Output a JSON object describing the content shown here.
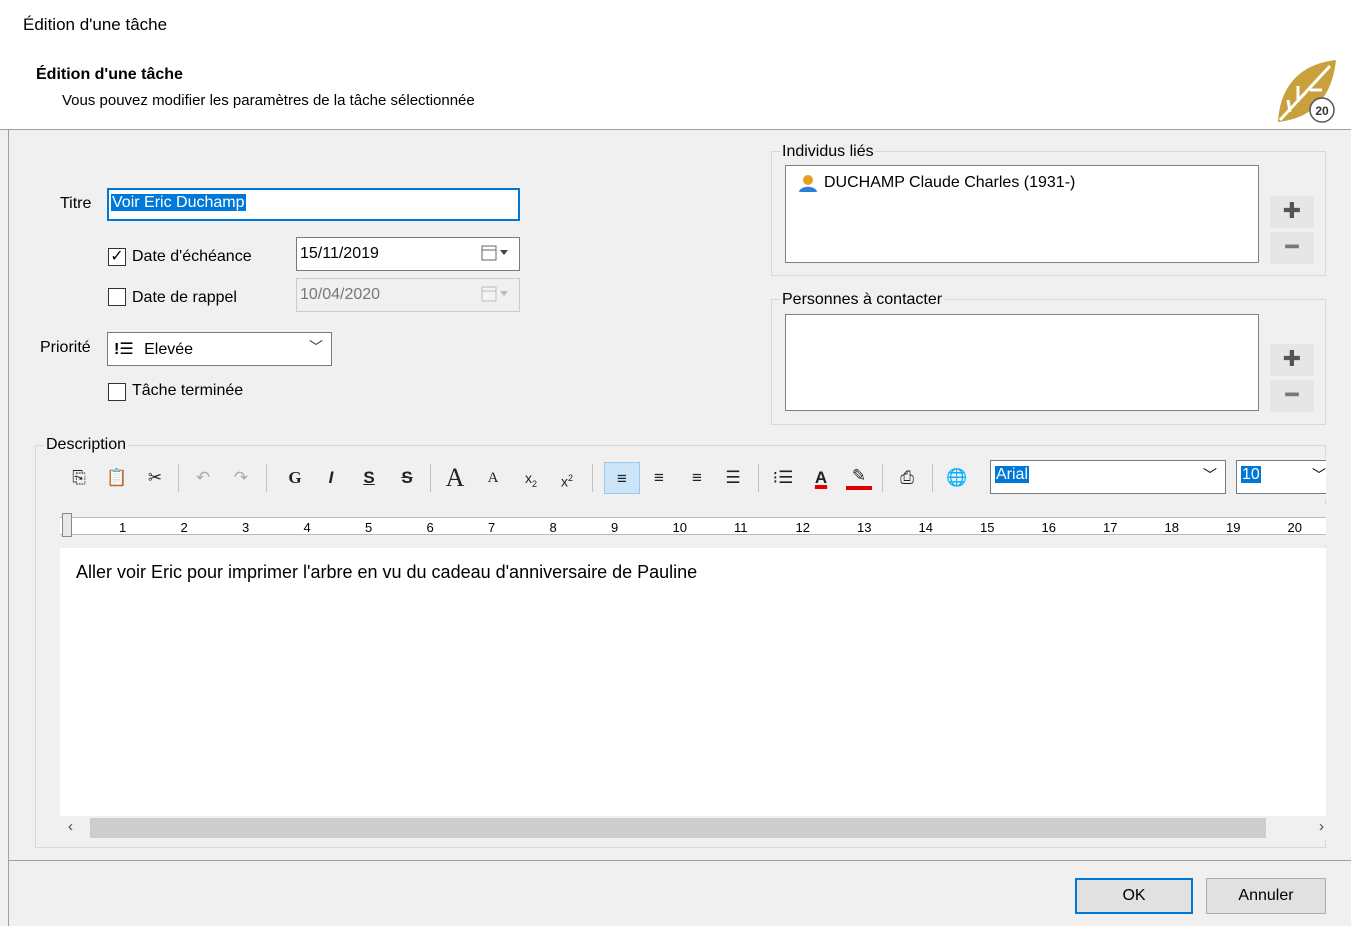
{
  "window": {
    "title": "Édition d'une tâche"
  },
  "banner": {
    "title": "Édition d'une tâche",
    "subtitle": "Vous pouvez modifier les paramètres de la tâche sélectionnée",
    "logo_text": "20"
  },
  "form": {
    "title_label": "Titre",
    "title_value": "Voir Eric Duchamp",
    "due_date_label": "Date d'échéance",
    "due_date_checked": true,
    "due_date_value": "15/11/2019",
    "reminder_label": "Date de rappel",
    "reminder_checked": false,
    "reminder_value": "10/04/2020",
    "priority_label": "Priorité",
    "priority_icon": "!☰",
    "priority_value": "Elevée",
    "done_label": "Tâche terminée",
    "done_checked": false
  },
  "linked": {
    "label": "Individus liés",
    "items": [
      "DUCHAMP Claude Charles (1931-)"
    ]
  },
  "contacts": {
    "label": "Personnes à contacter",
    "items": []
  },
  "description": {
    "label": "Description",
    "text": "Aller voir Eric pour imprimer l'arbre en vu du cadeau d'anniversaire de Pauline",
    "font_name": "Arial",
    "font_size": "10",
    "toolbar": {
      "bold": "G",
      "italic": "I",
      "underline": "S",
      "strike": "S",
      "grow": "A",
      "shrink": "A",
      "sub": "x",
      "sup": "x",
      "font_color": "A"
    },
    "ruler_numbers": [
      "1",
      "2",
      "3",
      "4",
      "5",
      "6",
      "7",
      "8",
      "9",
      "10",
      "11",
      "12",
      "13",
      "14",
      "15",
      "16",
      "17",
      "18",
      "19",
      "20"
    ]
  },
  "buttons": {
    "ok": "OK",
    "cancel": "Annuler"
  },
  "colors": {
    "accent": "#0078d7",
    "logo": "#c8a03c",
    "font_color_bar": "#e00000"
  }
}
